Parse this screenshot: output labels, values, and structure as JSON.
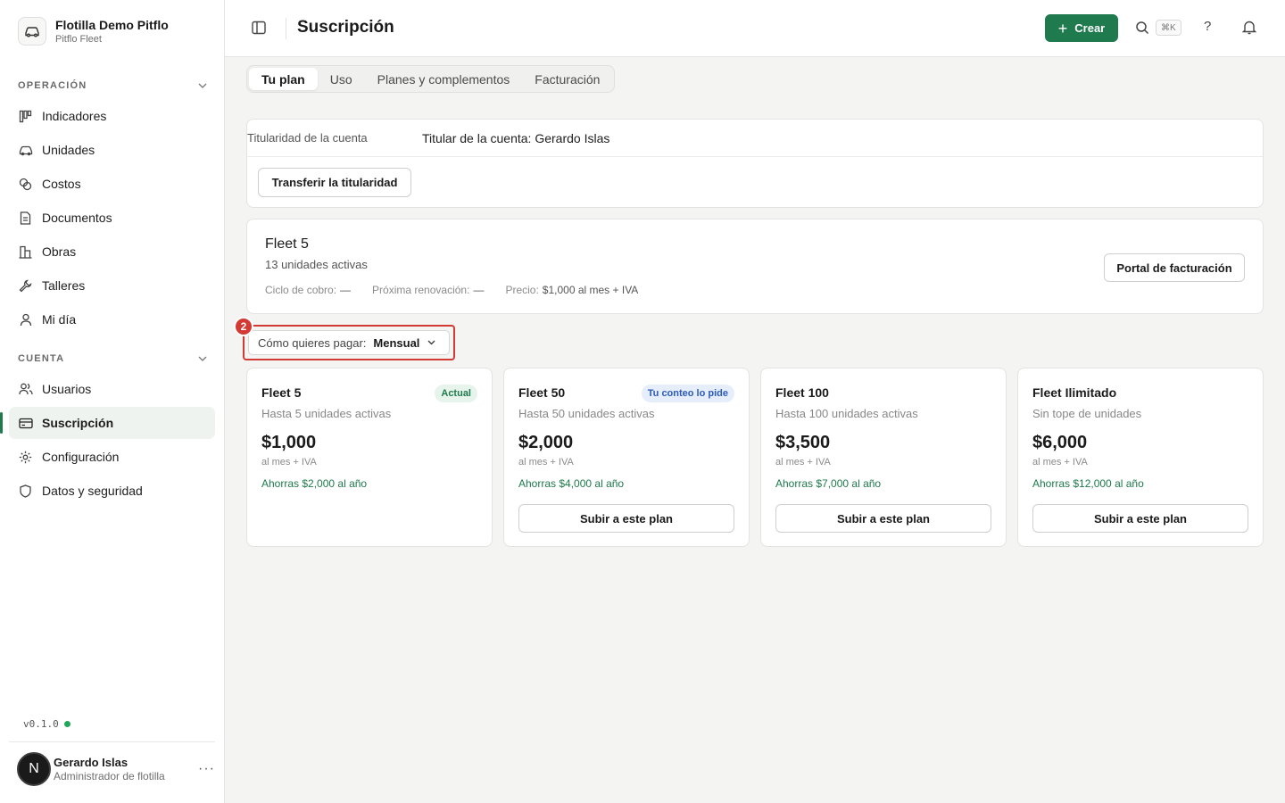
{
  "org": {
    "name": "Flotilla Demo Pitflo",
    "subtitle": "Pitflo Fleet"
  },
  "sidebar": {
    "sections": [
      {
        "title": "OPERACIÓN",
        "items": [
          {
            "label": "Indicadores",
            "icon": "bar-chart-icon"
          },
          {
            "label": "Unidades",
            "icon": "car-icon"
          },
          {
            "label": "Costos",
            "icon": "coins-icon"
          },
          {
            "label": "Documentos",
            "icon": "document-icon"
          },
          {
            "label": "Obras",
            "icon": "building-icon"
          },
          {
            "label": "Talleres",
            "icon": "wrench-icon"
          },
          {
            "label": "Mi día",
            "icon": "user-icon"
          }
        ]
      },
      {
        "title": "CUENTA",
        "items": [
          {
            "label": "Usuarios",
            "icon": "users-icon"
          },
          {
            "label": "Suscripción",
            "icon": "credit-card-icon",
            "active": true
          },
          {
            "label": "Configuración",
            "icon": "gear-icon"
          },
          {
            "label": "Datos y seguridad",
            "icon": "shield-icon"
          }
        ]
      }
    ],
    "version": "v0.1.0",
    "user": {
      "initial": "N",
      "name": "Gerardo Islas",
      "role": "Administrador de flotilla",
      "more": "···"
    }
  },
  "header": {
    "title": "Suscripción",
    "create_label": "Crear",
    "shortcut": "⌘K",
    "help": "?"
  },
  "tabs": [
    {
      "label": "Tu plan",
      "active": true
    },
    {
      "label": "Uso"
    },
    {
      "label": "Planes y complementos"
    },
    {
      "label": "Facturación"
    }
  ],
  "ownership": {
    "label": "Titularidad de la cuenta",
    "value": "Titular de la cuenta: Gerardo Islas",
    "transfer_label": "Transferir la titularidad"
  },
  "current_plan": {
    "name": "Fleet 5",
    "units": "13 unidades activas",
    "cycle_label": "Ciclo de cobro:",
    "cycle_value": "—",
    "renewal_label": "Próxima renovación:",
    "renewal_value": "—",
    "price_label": "Precio:",
    "price_value": "$1,000 al mes + IVA",
    "portal_label": "Portal de facturación"
  },
  "payment": {
    "badge": "2",
    "label": "Cómo quieres pagar:",
    "value": "Mensual"
  },
  "tiers": [
    {
      "name": "Fleet 5",
      "pill": "Actual",
      "desc": "Hasta 5 unidades activas",
      "price": "$1,000",
      "per": "al mes + IVA",
      "save": "Ahorras $2,000 al año",
      "button": ""
    },
    {
      "name": "Fleet 50",
      "pill": "Tu conteo lo pide",
      "desc": "Hasta 50 unidades activas",
      "price": "$2,000",
      "per": "al mes + IVA",
      "save": "Ahorras $4,000 al año",
      "button": "Subir a este plan"
    },
    {
      "name": "Fleet 100",
      "pill": "",
      "desc": "Hasta 100 unidades activas",
      "price": "$3,500",
      "per": "al mes + IVA",
      "save": "Ahorras $7,000 al año",
      "button": "Subir a este plan"
    },
    {
      "name": "Fleet Ilimitado",
      "pill": "",
      "desc": "Sin tope de unidades",
      "price": "$6,000",
      "per": "al mes + IVA",
      "save": "Ahorras $12,000 al año",
      "button": "Subir a este plan"
    }
  ],
  "colors": {
    "accent": "#1f7a4d",
    "highlight": "#d33a33",
    "info": "#2d5bb9"
  }
}
